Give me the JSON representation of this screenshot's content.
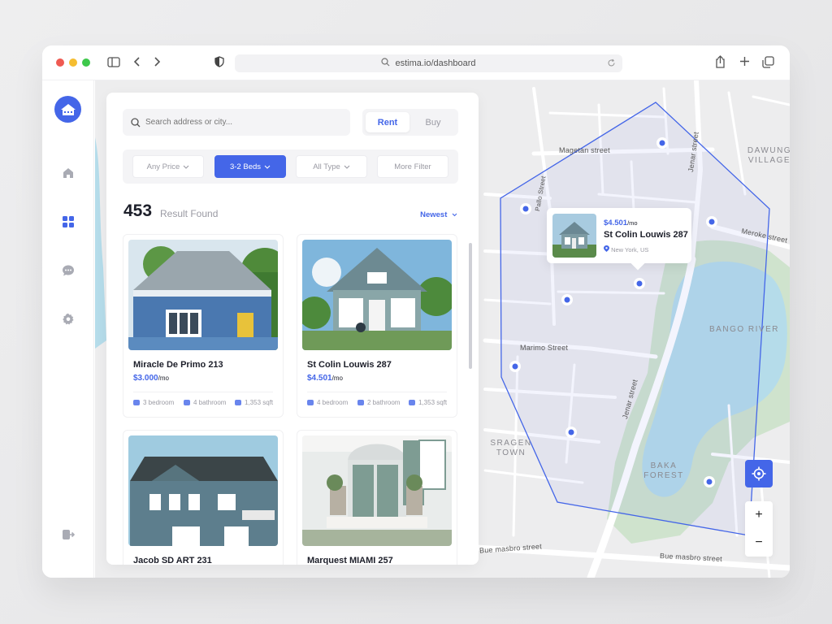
{
  "browser": {
    "url": "estima.io/dashboard"
  },
  "search": {
    "placeholder": "Search address or city..."
  },
  "toggle": {
    "rent": "Rent",
    "buy": "Buy",
    "selected": "Rent"
  },
  "filters": {
    "price": "Any Price",
    "beds": "3-2 Beds",
    "type": "All Type",
    "more": "More Filter"
  },
  "results": {
    "count": "453",
    "label": "Result Found",
    "sort": "Newest"
  },
  "listings": [
    {
      "name": "Miracle De Primo 213",
      "price": "$3.000",
      "per": "/mo",
      "bedroom": "3 bedroom",
      "bathroom": "4 bathroom",
      "sqft": "1,353 sqft"
    },
    {
      "name": "St Colin Louwis 287",
      "price": "$4.501",
      "per": "/mo",
      "bedroom": "4 bedroom",
      "bathroom": "2 bathroom",
      "sqft": "1,353 sqft"
    },
    {
      "name": "Jacob SD ART 231"
    },
    {
      "name": "Marquest MIAMI 257"
    }
  ],
  "map": {
    "streets": [
      "Magetan street",
      "Jenar street",
      "Meroke street",
      "Marimo Street",
      "Jenar street",
      "Bue masbro street",
      "Bue masbro street",
      "Pallo Street"
    ],
    "areas": [
      "DAWUNG VILLAGE",
      "BANGO RIVER",
      "SRAGEN TOWN",
      "BAKA FOREST"
    ],
    "popup": {
      "price": "$4.501",
      "per": "/mo",
      "name": "St Colin Louwis 287",
      "location": "New York, US"
    },
    "zoom_in": "+",
    "zoom_out": "−"
  },
  "colors": {
    "accent": "#4466e8",
    "map_bg": "#ededee",
    "water": "#b5dcea",
    "park": "#cfe3cd"
  }
}
